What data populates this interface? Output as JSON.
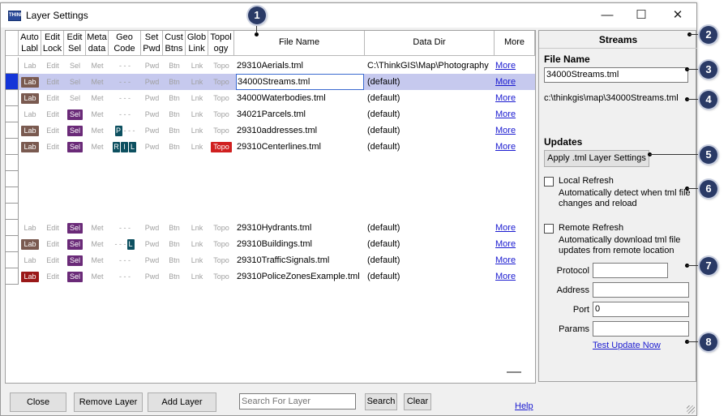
{
  "window": {
    "title": "Layer Settings",
    "app_icon_text": "THINK GIS",
    "minimize": "—",
    "maximize": "☐",
    "close": "✕"
  },
  "grid": {
    "columns": {
      "auto_label": [
        "Auto",
        "Labl"
      ],
      "edit_lock": [
        "Edit",
        "Lock"
      ],
      "edit_sel": [
        "Edit",
        "Sel"
      ],
      "meta": [
        "Meta",
        "data"
      ],
      "geo": [
        "Geo",
        "Code"
      ],
      "set_pwd": [
        "Set",
        "Pwd"
      ],
      "cust_btns": [
        "Cust",
        "Btns"
      ],
      "glob_link": [
        "Glob",
        "Link"
      ],
      "topology": [
        "Topol",
        "ogy"
      ],
      "file_name": "File Name",
      "data_dir": "Data Dir",
      "more": "More"
    },
    "cell_text": {
      "lab": "Lab",
      "edit": "Edit",
      "sel": "Sel",
      "met": "Met",
      "geo_dashes": "- - -",
      "pwd": "Pwd",
      "btn": "Btn",
      "lnk": "Lnk",
      "topo": "Topo",
      "more_link": "More"
    },
    "rows": [
      {
        "file": "29310Aerials.tml",
        "dir": "C:\\ThinkGIS\\Map\\Photography",
        "lab": false,
        "lab_red": false,
        "sel": false,
        "geo": [],
        "topo": false,
        "selected": false
      },
      {
        "file": "34000Streams.tml",
        "dir": "(default)",
        "lab": true,
        "lab_red": false,
        "sel": false,
        "geo": [],
        "topo": false,
        "selected": true
      },
      {
        "file": "34000Waterbodies.tml",
        "dir": "(default)",
        "lab": true,
        "lab_red": false,
        "sel": false,
        "geo": [],
        "topo": false,
        "selected": false
      },
      {
        "file": "34021Parcels.tml",
        "dir": "(default)",
        "lab": false,
        "lab_red": false,
        "sel": true,
        "geo": [],
        "topo": false,
        "selected": false
      },
      {
        "file": "29310addresses.tml",
        "dir": "(default)",
        "lab": true,
        "lab_red": false,
        "sel": true,
        "geo": [
          "P"
        ],
        "topo": false,
        "selected": false
      },
      {
        "file": "29310Centerlines.tml",
        "dir": "(default)",
        "lab": true,
        "lab_red": false,
        "sel": true,
        "geo": [
          "R",
          "I",
          "L"
        ],
        "topo": true,
        "selected": false
      },
      null,
      null,
      null,
      null,
      {
        "file": "29310Hydrants.tml",
        "dir": "(default)",
        "lab": false,
        "lab_red": false,
        "sel": true,
        "geo": [],
        "topo": false,
        "selected": false
      },
      {
        "file": "29310Buildings.tml",
        "dir": "(default)",
        "lab": true,
        "lab_red": false,
        "sel": true,
        "geo": [
          "L"
        ],
        "topo": false,
        "selected": false
      },
      {
        "file": "29310TrafficSignals.tml",
        "dir": "(default)",
        "lab": false,
        "lab_red": false,
        "sel": true,
        "geo": [],
        "topo": false,
        "selected": false
      },
      {
        "file": "29310PoliceZonesExample.tml",
        "dir": "(default)",
        "lab": true,
        "lab_red": true,
        "sel": true,
        "geo": [],
        "topo": false,
        "selected": false
      }
    ]
  },
  "panel": {
    "title": "Streams",
    "file_name_label": "File Name",
    "file_name_value": "34000Streams.tml",
    "path": "c:\\thinkgis\\map\\34000Streams.tml",
    "updates_label": "Updates",
    "apply_button": "Apply .tml Layer Settings",
    "local_refresh_label": "Local Refresh",
    "local_refresh_desc": "Automatically detect when tml file changes and reload",
    "remote_refresh_label": "Remote Refresh",
    "remote_refresh_desc": "Automatically download tml file updates from remote location",
    "protocol_label": "Protocol",
    "protocol_value": "",
    "address_label": "Address",
    "address_value": "",
    "port_label": "Port",
    "port_value": "0",
    "params_label": "Params",
    "params_value": "",
    "test_link": "Test Update Now"
  },
  "footer": {
    "close_button": "Close",
    "remove_button": "Remove Layer",
    "add_button": "Add Layer",
    "search_placeholder": "Search For Layer",
    "search_button": "Search",
    "clear_button": "Clear",
    "help_link": "Help"
  },
  "callouts": [
    "1",
    "2",
    "3",
    "4",
    "5",
    "6",
    "7",
    "8"
  ],
  "colors": {
    "selected_row": "#c6c9ee",
    "selected_row_header": "#1435d8",
    "label_badge": "#7a5a50",
    "label_badge_red": "#9a1818",
    "select_badge": "#6a2a78",
    "geocode_badge": "#0d5060",
    "topology_badge": "#d02020",
    "callout": "#2a3a66",
    "link": "#1a1ad0"
  }
}
